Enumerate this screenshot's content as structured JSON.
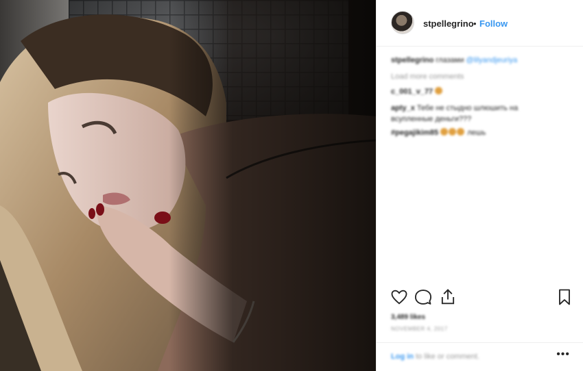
{
  "post": {
    "photo_alt": "",
    "author": {
      "username": "stpellegrino",
      "separator": "•",
      "follow_label": "Follow"
    },
    "caption": {
      "username": "stpellegrino",
      "text": "глазами",
      "mention": "@lilyandjeuriya"
    },
    "load_more_label": "Load more comments",
    "comments": [
      {
        "username": "c_001_v_77",
        "text": ""
      },
      {
        "username": "apty_x",
        "text": "Тебе не стыдно шлюшить на"
      },
      {
        "text": "всупленные деньги???"
      },
      {
        "username": "#pegajikim85",
        "text": "лешь"
      }
    ],
    "actions": {
      "like_icon": "heart-icon",
      "comment_icon": "comment-icon",
      "share_icon": "share-icon",
      "save_icon": "bookmark-icon"
    },
    "likes_text": "3,489 likes",
    "date_text": "NOVEMBER 4, 2017",
    "login_prompt": {
      "link": "Log in",
      "text": "to like or comment."
    },
    "more_label": "•••",
    "colors": {
      "link": "#3897f0",
      "text": "#262626",
      "muted": "#999999",
      "border": "#efefef"
    }
  }
}
